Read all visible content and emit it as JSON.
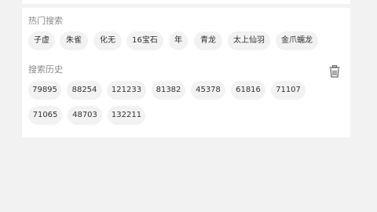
{
  "hot_search": {
    "title": "热门搜索",
    "items": [
      "子虚",
      "朱雀",
      "化无",
      "16宝石",
      "年",
      "青龙",
      "太上仙羽",
      "金爪蠕龙"
    ]
  },
  "history": {
    "title": "搜索历史",
    "clear_icon": "trash-icon",
    "items": [
      "79895",
      "88254",
      "121233",
      "81382",
      "45378",
      "61816",
      "71107",
      "71065",
      "48703",
      "132211"
    ]
  },
  "colors": {
    "chip_bg": "#f2f2f2",
    "chip_text": "#333333",
    "title_text": "#8a8a8a",
    "page_bg": "#f2f2f2",
    "card_bg": "#ffffff"
  }
}
